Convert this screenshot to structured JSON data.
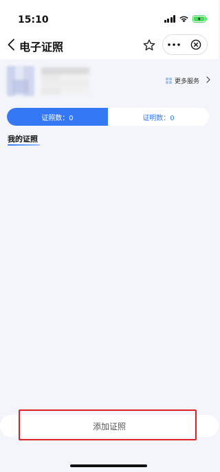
{
  "status_bar": {
    "time": "15:10"
  },
  "nav": {
    "title": "电子证照"
  },
  "profile": {
    "more_services_label": "更多服务"
  },
  "tabs": [
    {
      "label": "证照数：0",
      "active": true
    },
    {
      "label": "证明数：0",
      "active": false
    }
  ],
  "section": {
    "title": "我的证照"
  },
  "bottom": {
    "add_button_label": "添加证照"
  },
  "colors": {
    "accent": "#3478f6",
    "background": "#f3f5fa",
    "highlight": "#e02020",
    "battery": "#4cd964"
  }
}
